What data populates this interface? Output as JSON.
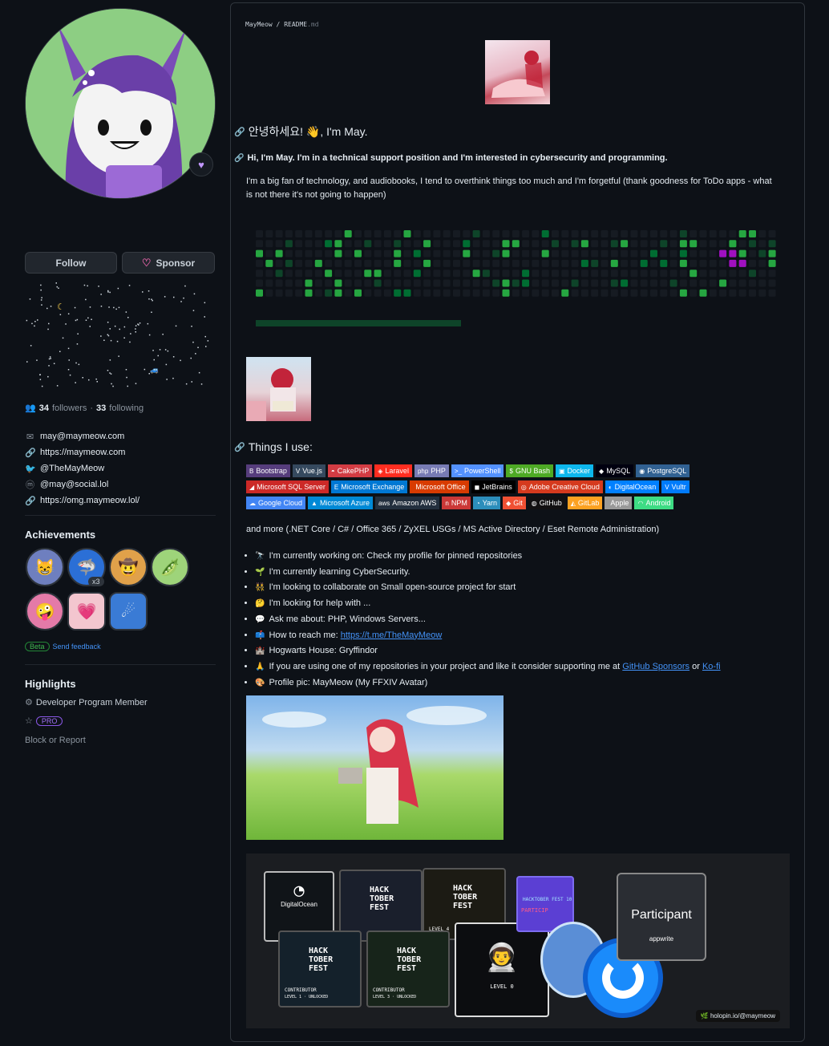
{
  "profile": {
    "follow_label": "Follow",
    "sponsor_label": "Sponsor",
    "followers_count": "34",
    "followers_label": "followers",
    "separator": "·",
    "following_count": "33",
    "following_label": "following"
  },
  "links": [
    {
      "icon": "mail-icon",
      "text": "may@maymeow.com"
    },
    {
      "icon": "link-icon",
      "text": "https://maymeow.com"
    },
    {
      "icon": "twitter-icon",
      "text": "@TheMayMeow"
    },
    {
      "icon": "mastodon-icon",
      "text": "@may@social.lol"
    },
    {
      "icon": "link-icon",
      "text": "https://omg.maymeow.lol/"
    }
  ],
  "achievements": {
    "title": "Achievements",
    "multiplier": "x3",
    "beta_label": "Beta",
    "feedback_label": "Send feedback"
  },
  "highlights": {
    "title": "Highlights",
    "developer_program": "Developer Program Member",
    "pro_label": "PRO",
    "block_label": "Block or Report"
  },
  "readme": {
    "crumb_user": "MayMeow",
    "crumb_sep": "/",
    "crumb_file": "README",
    "crumb_ext": ".md",
    "heading": "안녕하세요! 👋, I'm May.",
    "subheading": "Hi, I'm May. I'm in a technical support position and I'm interested in cybersecurity and programming.",
    "intro": "I'm a big fan of technology, and audiobooks, I tend to overthink things too much and I'm forgetful (thank goodness for ToDo apps - what is not there it's not going to happen)",
    "things_heading": "Things I use:",
    "tag_rows": [
      [
        {
          "label": "Bootstrap",
          "color": "#563d7c",
          "icon": "B"
        },
        {
          "label": "Vue.js",
          "color": "#35495e",
          "icon": "V"
        },
        {
          "label": "CakePHP",
          "color": "#d33c43",
          "icon": "◓"
        },
        {
          "label": "Laravel",
          "color": "#ff2d20",
          "icon": "◈"
        },
        {
          "label": "PHP",
          "color": "#777bb4",
          "icon": "php"
        },
        {
          "label": "PowerShell",
          "color": "#5391fe",
          "icon": ">_"
        },
        {
          "label": "GNU Bash",
          "color": "#4eaa25",
          "icon": "$"
        },
        {
          "label": "Docker",
          "color": "#0db7ed",
          "icon": "▣"
        },
        {
          "label": "MySQL",
          "color": "#00000f",
          "icon": "◆"
        },
        {
          "label": "PostgreSQL",
          "color": "#316192",
          "icon": "◉"
        }
      ],
      [
        {
          "label": "Microsoft SQL Server",
          "color": "#cc2927",
          "icon": "◢"
        },
        {
          "label": "Microsoft Exchange",
          "color": "#0078d4",
          "icon": "E"
        },
        {
          "label": "Microsoft Office",
          "color": "#d83b01",
          "icon": ""
        },
        {
          "label": "JetBrains",
          "color": "#000000",
          "icon": "◼"
        },
        {
          "label": "Adobe Creative Cloud",
          "color": "#d53a1e",
          "icon": "◎"
        },
        {
          "label": "DigitalOcean",
          "color": "#0080ff",
          "icon": "◐"
        },
        {
          "label": "Vultr",
          "color": "#007bfc",
          "icon": "V"
        }
      ],
      [
        {
          "label": "Google Cloud",
          "color": "#4285f4",
          "icon": "☁"
        },
        {
          "label": "Microsoft Azure",
          "color": "#0089d6",
          "icon": "▲"
        },
        {
          "label": "Amazon AWS",
          "color": "#232f3e",
          "icon": "aws"
        },
        {
          "label": "NPM",
          "color": "#cb3837",
          "icon": "n"
        },
        {
          "label": "Yarn",
          "color": "#2c8ebb",
          "icon": "◔"
        },
        {
          "label": "Git",
          "color": "#f05033",
          "icon": "◆"
        },
        {
          "label": "GitHub",
          "color": "#121011",
          "icon": "◍"
        },
        {
          "label": "GitLab",
          "color": "#fca121",
          "icon": "◭"
        },
        {
          "label": "Apple",
          "color": "#999999",
          "icon": ""
        },
        {
          "label": "Android",
          "color": "#3ddc84",
          "icon": "◠"
        }
      ]
    ],
    "and_more": "and more (.NET Core / C# / Office 365 / ZyXEL USGs / MS Active Directory / Eset Remote Administration)",
    "bullets": [
      {
        "emoji": "🔭",
        "text": "I'm currently working on: Check my profile for pinned repositories"
      },
      {
        "emoji": "🌱",
        "text": "I'm currently learning CyberSecurity."
      },
      {
        "emoji": "👯",
        "text": "I'm looking to collaborate on Small open-source project for start"
      },
      {
        "emoji": "🤔",
        "text": "I'm looking for help with ..."
      },
      {
        "emoji": "💬",
        "text": "Ask me about: PHP, Windows Servers..."
      },
      {
        "emoji": "📫",
        "text": "How to reach me: ",
        "link": "https://t.me/TheMayMeow"
      },
      {
        "emoji": "🏰",
        "text": "Hogwarts House: Gryffindor"
      },
      {
        "emoji": "🙏",
        "text": "If you are using one of my repositories in your project and like it consider supporting me at ",
        "link": "GitHub Sponsors",
        "mid": " or ",
        "link2": "Ko-fi"
      },
      {
        "emoji": "🎨",
        "text": "Profile pic: MayMeow (My FFXIV Avatar)"
      }
    ],
    "holopin_credit": "holopin.io/@maymeow",
    "holopin": {
      "digitalocean": "DigitalOcean",
      "hack1": "HACK TOBER FEST",
      "contributor": "CONTRIBUTOR",
      "level1": "LEVEL 1 · UNLOCKED",
      "level3": "LEVEL 3 · UNLOCKED",
      "level4": "LEVEL 4",
      "level0": "LEVEL 0",
      "participant": "Participant",
      "appwrite": "appwrite",
      "hacktober10": "HACKTOBER FEST 10",
      "particip": "PARTICIP"
    }
  }
}
